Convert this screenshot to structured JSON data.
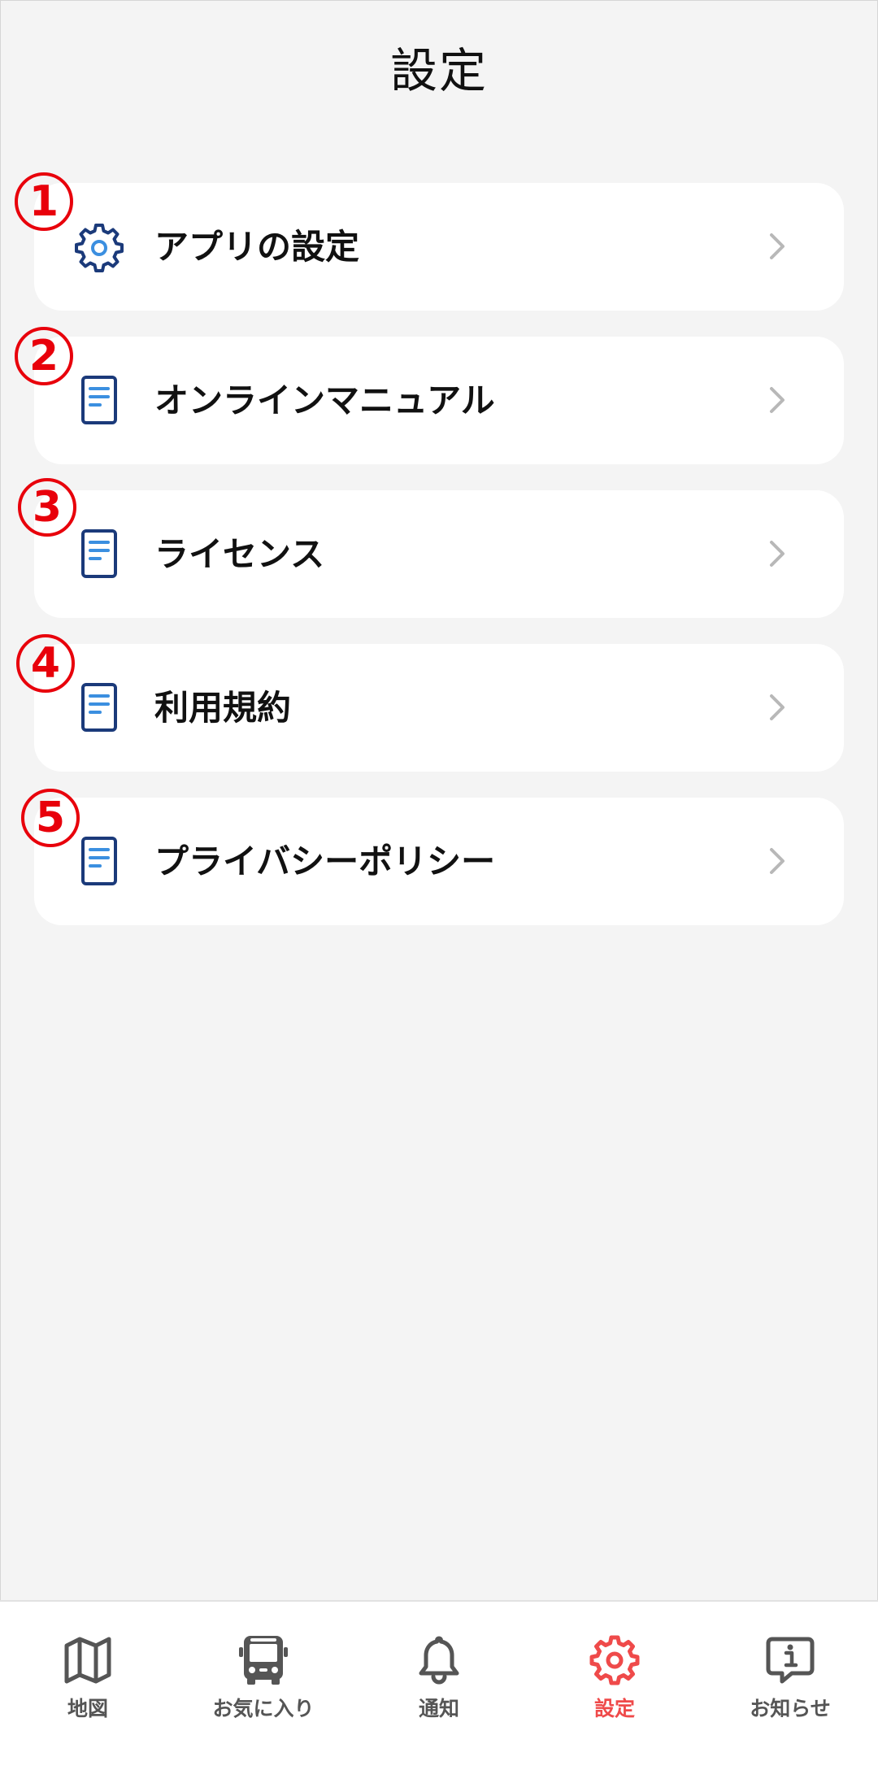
{
  "header": {
    "title": "設定"
  },
  "settings": {
    "items": [
      {
        "badge": "1",
        "label": "アプリの設定",
        "icon": "gear-icon"
      },
      {
        "badge": "2",
        "label": "オンラインマニュアル",
        "icon": "document-icon"
      },
      {
        "badge": "3",
        "label": "ライセンス",
        "icon": "document-icon"
      },
      {
        "badge": "4",
        "label": "利用規約",
        "icon": "document-icon"
      },
      {
        "badge": "5",
        "label": "プライバシーポリシー",
        "icon": "document-icon"
      }
    ]
  },
  "tab_bar": {
    "active_index": 3,
    "tabs": [
      {
        "label": "地図",
        "icon": "map-icon"
      },
      {
        "label": "お気に入り",
        "icon": "bus-icon"
      },
      {
        "label": "通知",
        "icon": "bell-icon"
      },
      {
        "label": "設定",
        "icon": "gear-icon"
      },
      {
        "label": "お知らせ",
        "icon": "info-bubble-icon"
      }
    ]
  },
  "colors": {
    "background": "#f4f4f4",
    "card": "#ffffff",
    "icon_navy": "#1b3a7a",
    "icon_blue": "#3b8fe0",
    "badge_red": "#e8000b",
    "active_tab": "#ef4a4a",
    "inactive_tab": "#555555",
    "chevron": "#b8b8b8"
  }
}
